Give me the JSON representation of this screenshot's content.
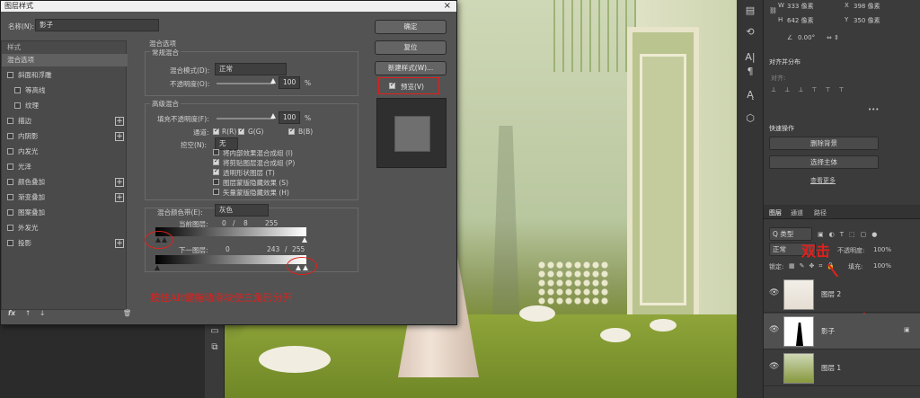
{
  "dialog": {
    "title": "图层样式",
    "close": "×",
    "name_label": "名称(N):",
    "name_value": "影子",
    "styles_header": "样式",
    "style_items": [
      {
        "label": "混合选项",
        "checkbox": false,
        "plus": false,
        "selected": true
      },
      {
        "label": "斜面和浮雕",
        "checkbox": true,
        "plus": false
      },
      {
        "label": "等高线",
        "checkbox": true,
        "plus": false,
        "indent": true
      },
      {
        "label": "纹理",
        "checkbox": true,
        "plus": false,
        "indent": true
      },
      {
        "label": "描边",
        "checkbox": true,
        "plus": true
      },
      {
        "label": "内阴影",
        "checkbox": true,
        "plus": true
      },
      {
        "label": "内发光",
        "checkbox": true,
        "plus": false
      },
      {
        "label": "光泽",
        "checkbox": true,
        "plus": false
      },
      {
        "label": "颜色叠加",
        "checkbox": true,
        "plus": true
      },
      {
        "label": "渐变叠加",
        "checkbox": true,
        "plus": true
      },
      {
        "label": "图案叠加",
        "checkbox": true,
        "plus": false
      },
      {
        "label": "外发光",
        "checkbox": true,
        "plus": false
      },
      {
        "label": "投影",
        "checkbox": true,
        "plus": true
      }
    ],
    "bottom_icons": [
      "fx",
      "↑",
      "↓",
      "🗑"
    ],
    "blend_options_title": "混合选项",
    "general_blend_title": "常规混合",
    "blend_mode_label": "混合模式(D):",
    "blend_mode_value": "正常",
    "opacity_label": "不透明度(O):",
    "opacity_value": "100",
    "opacity_unit": "%",
    "advanced_blend_title": "高级混合",
    "fill_opacity_label": "填充不透明度(F):",
    "fill_opacity_value": "100",
    "fill_opacity_unit": "%",
    "channels_label": "通道:",
    "channel_r": "R(R)",
    "channel_g": "G(G)",
    "channel_b": "B(B)",
    "knockout_label": "挖空(N):",
    "knockout_value": "无",
    "adv_options": [
      {
        "label": "将内部效果混合成组 (I)",
        "checked": false
      },
      {
        "label": "将剪贴图层混合成组 (P)",
        "checked": true
      },
      {
        "label": "透明形状图层 (T)",
        "checked": true
      },
      {
        "label": "图层蒙版隐藏效果 (S)",
        "checked": false
      },
      {
        "label": "矢量蒙版隐藏效果 (H)",
        "checked": false
      }
    ],
    "blend_if_label": "混合颜色带(E):",
    "blend_if_value": "灰色",
    "this_layer_label": "当前图层:",
    "this_layer_values": [
      "0",
      "/",
      "8",
      "255"
    ],
    "underlying_label": "下一图层:",
    "underlying_values": [
      "0",
      "243",
      "/",
      "255"
    ],
    "ok": "确定",
    "reset": "复位",
    "new_style": "新建样式(W)...",
    "preview_label": "预览(V)",
    "annotation": "按住Alt键拖动滑块使三角形分开"
  },
  "properties": {
    "w_label": "W",
    "w_value": "333 像素",
    "h_label": "H",
    "h_value": "642 像素",
    "x_label": "X",
    "x_value": "398 像素",
    "y_label": "Y",
    "y_value": "350 像素",
    "angle_value": "0.00°",
    "align_title": "对齐并分布",
    "align_sub": "对齐:",
    "more": "•••",
    "quick_title": "快速操作",
    "remove_bg": "删除背景",
    "select_subject": "选择主体",
    "learn_more": "查看更多"
  },
  "layers_panel": {
    "tabs": [
      "图层",
      "通道",
      "路径"
    ],
    "kind_label": "Q 类型",
    "mode_value": "正常",
    "opacity_label": "不透明度:",
    "opacity_value": "100%",
    "lock_label": "锁定:",
    "fill_label": "填充:",
    "fill_value": "100%",
    "annotation": "双击",
    "layers": [
      {
        "name": "图层 2",
        "selected": false
      },
      {
        "name": "影子",
        "selected": true
      },
      {
        "name": "图层 1",
        "selected": false
      }
    ]
  },
  "colors": {
    "annotation_red": "#e0201c",
    "dialog_bg": "#535353",
    "panel_bg": "#3b3b3b"
  }
}
